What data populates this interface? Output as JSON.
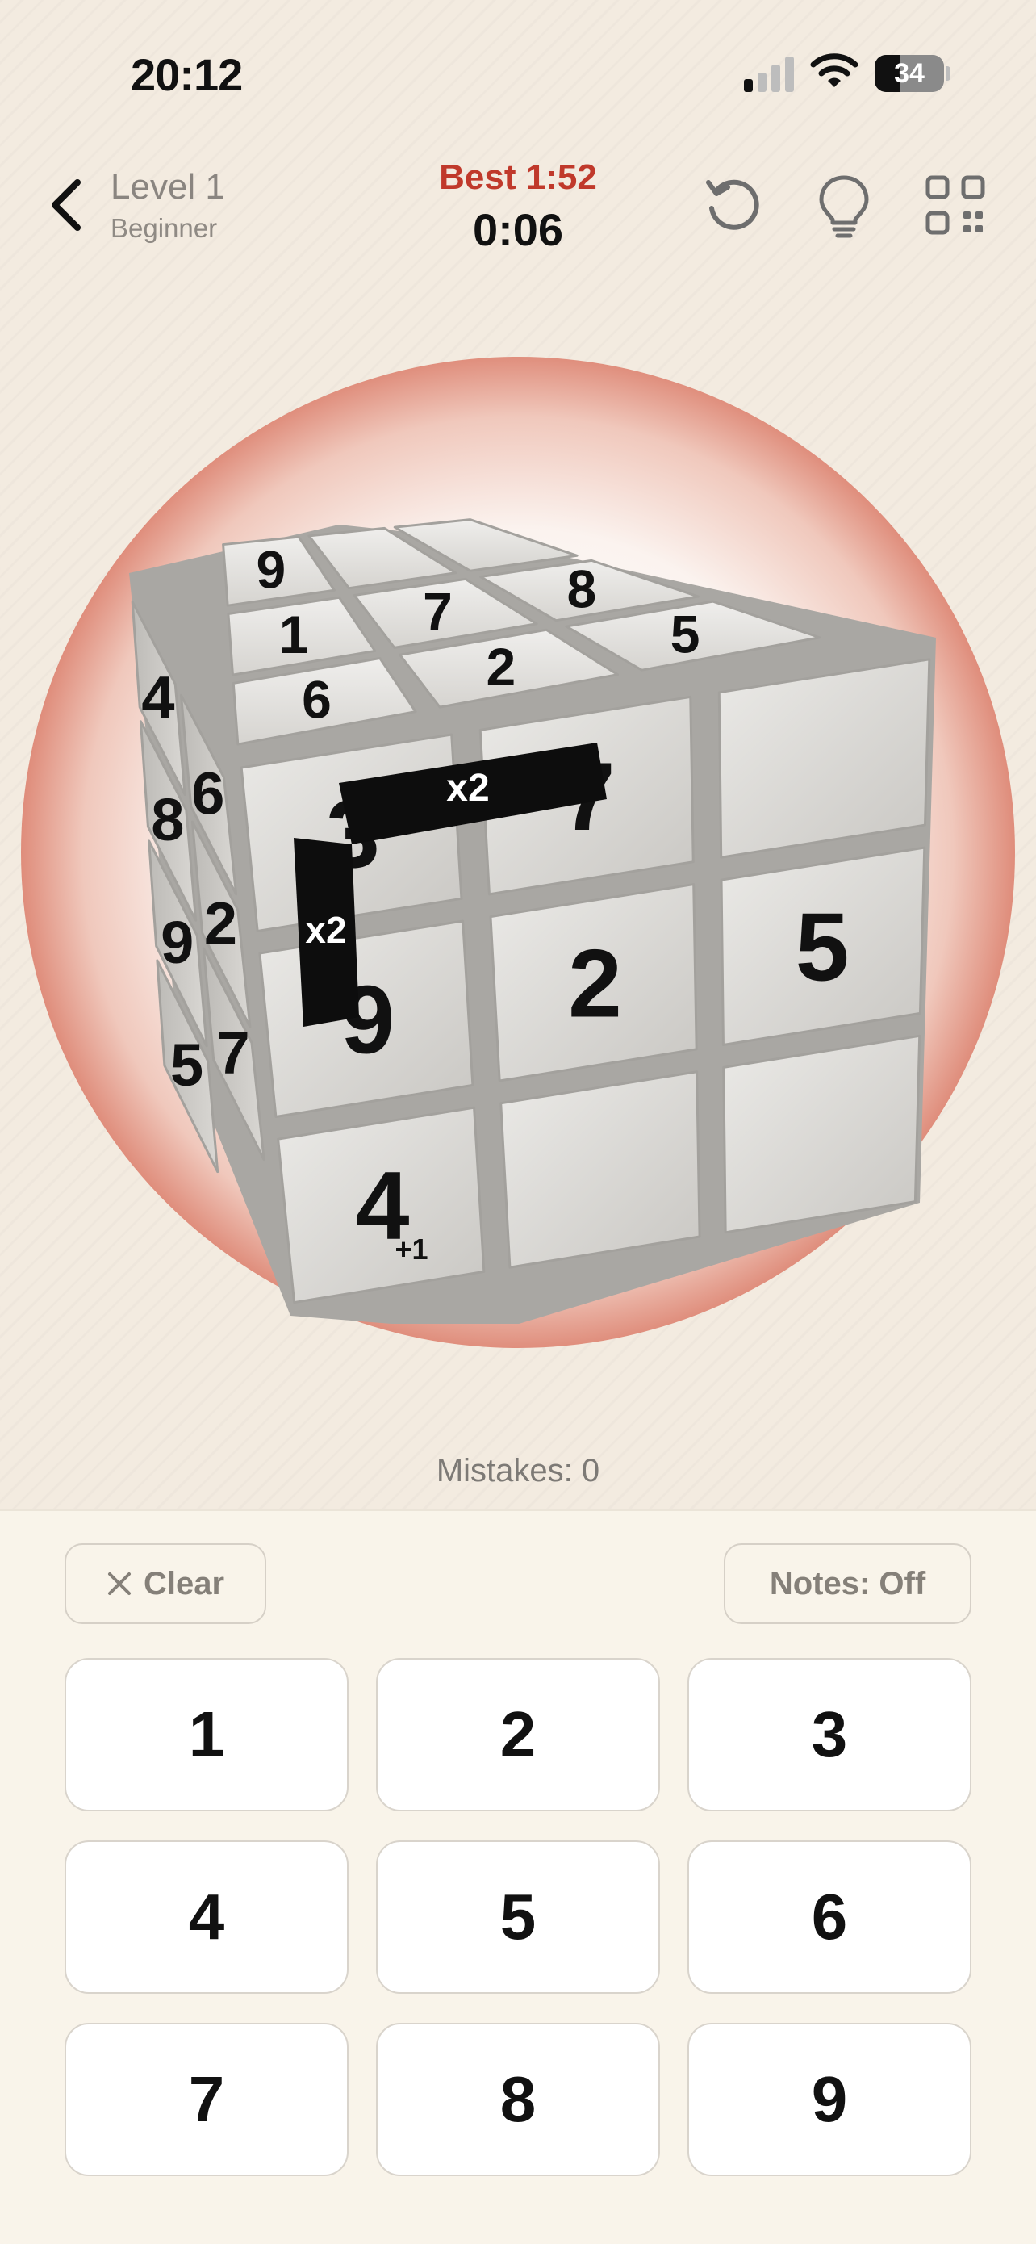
{
  "status_bar": {
    "time": "20:12",
    "battery": "34"
  },
  "header": {
    "level_title": "Level 1",
    "level_subtitle": "Beginner",
    "best": "Best 1:52",
    "timer": "0:06"
  },
  "icons": {
    "back": "chevron-left-icon",
    "restart": "restart-icon",
    "hint": "lightbulb-icon",
    "qr": "qr-code-icon",
    "clear": "close-icon"
  },
  "cube": {
    "top_face": [
      "9",
      "",
      "",
      "1",
      "7",
      "8",
      "6",
      "2",
      "5"
    ],
    "front_face": [
      "3",
      "7",
      "",
      "9",
      "2",
      "5",
      "4",
      "",
      ""
    ],
    "left_face": [
      "4",
      "6",
      "8",
      "2",
      "9",
      "7",
      "5",
      ""
    ],
    "multipliers": [
      "x2",
      "x2"
    ],
    "bonus": "+1"
  },
  "colors": {
    "accent": "#c0392b",
    "panel": "#f9f4ea",
    "background": "#f3ebe0"
  },
  "mistakes": "Mistakes: 0",
  "controls": {
    "clear_label": "Clear",
    "notes_label": "Notes: Off"
  },
  "keypad": [
    "1",
    "2",
    "3",
    "4",
    "5",
    "6",
    "7",
    "8",
    "9"
  ]
}
